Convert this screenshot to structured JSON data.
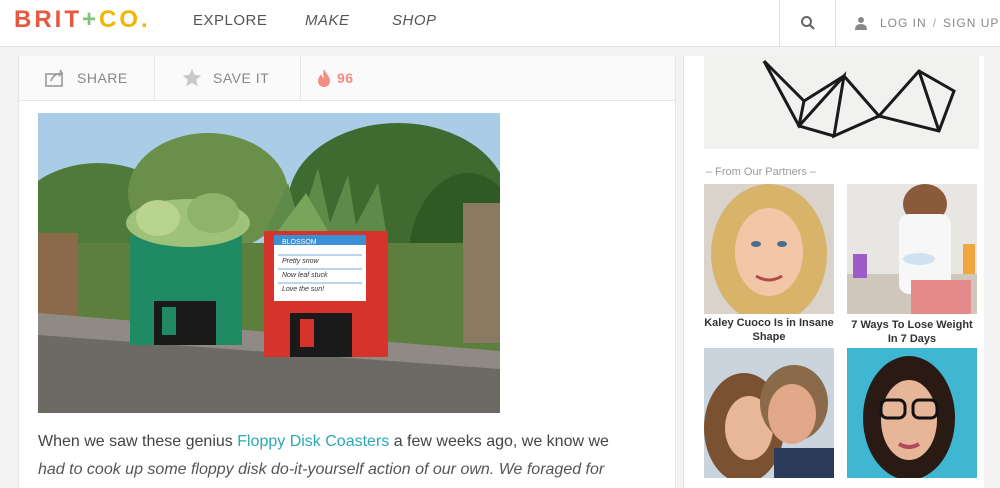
{
  "header": {
    "logo": {
      "brit": "BRIT",
      "plus": "+",
      "co": "CO."
    },
    "nav": {
      "explore": "EXPLORE",
      "make": "MAKE",
      "shop": "SHOP"
    },
    "login": "LOG IN",
    "separator": "/",
    "signup": "SIGN UP"
  },
  "sharebar": {
    "share": "SHARE",
    "save": "SAVE IT",
    "fire_count": "96"
  },
  "article": {
    "text_before": "When we saw these genius ",
    "link": "Floppy Disk Coasters",
    "text_after": " a few weeks ago, we know we",
    "line2": "had to cook up some floppy disk do-it-yourself action of our own. We foraged for",
    "disk_label": {
      "title": "BLOSSOM",
      "lines": [
        "Pretty snow",
        "Now leaf stuck",
        "Love the sun!"
      ]
    }
  },
  "sidebar": {
    "partners_label": "– From Our Partners –",
    "tiles": [
      {
        "caption": "Kaley Cuoco Is in Insane Shape"
      },
      {
        "caption": "7 Ways To Lose Weight In 7 Days"
      },
      {
        "caption": ""
      },
      {
        "caption": ""
      }
    ]
  },
  "colors": {
    "accent_teal": "#2aa9b5",
    "fire": "#f08f82",
    "logo_red": "#e8573f",
    "logo_green": "#7cc576",
    "logo_yellow": "#f4b400"
  }
}
